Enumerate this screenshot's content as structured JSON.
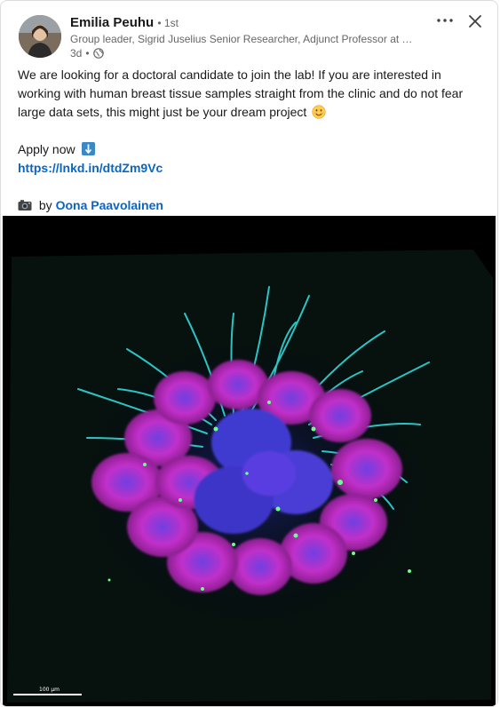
{
  "post": {
    "author": {
      "name": "Emilia Peuhu",
      "degree": "• 1st",
      "headline": "Group leader, Sigrid Juselius Senior Researcher, Adjunct Professor at Tu...",
      "time": "3d",
      "visibility_icon": "globe-icon"
    },
    "body": {
      "paragraph1": "We are looking for a doctoral candidate to join the lab! If you are interested in working with human breast tissue samples straight from the clinic and do not fear large data sets, this might just be your dream project",
      "paragraph1_emoji": "smiling-face-emoji",
      "apply": "Apply now",
      "apply_emoji": "down-arrow-emoji",
      "link": "https://lnkd.in/dtdZm9Vc",
      "credit_prefix": "by",
      "credit_emoji": "camera-emoji",
      "credit_name": "Oona Paavolainen"
    },
    "image": {
      "scale_bar_label": "100 µm"
    }
  },
  "colors": {
    "link": "#0a66c2",
    "text": "#191919",
    "muted": "#666666",
    "magenta": "#d32fd3",
    "cyan": "#2fd8d8",
    "blue": "#3a3ad0",
    "green": "#6cff8a"
  }
}
